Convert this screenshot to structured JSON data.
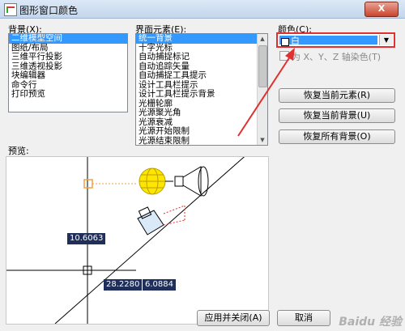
{
  "window": {
    "title": "图形窗口颜色",
    "close_label": "X"
  },
  "context": {
    "label": "背景(X):",
    "items": [
      "二维模型空间",
      "图纸/布局",
      "三维平行投影",
      "三维透视投影",
      "块编辑器",
      "命令行",
      "打印预览"
    ],
    "selected_index": 0
  },
  "interface_element": {
    "label": "界面元素(E):",
    "items": [
      "统一背景",
      "十字光标",
      "自动捕捉标记",
      "自动追踪矢量",
      "自动捕捉工具提示",
      "设计工具栏提示",
      "设计工具栏提示背景",
      "光栅轮廓",
      "光源聚光角",
      "光源衰减",
      "光源开始限制",
      "光源结束限制",
      "相机轮廓色",
      "相机视野/平截面"
    ],
    "selected_index": 0
  },
  "color": {
    "label": "颜色(C):",
    "value": "白",
    "swatch_color": "#ffffff",
    "tint_checkbox_label": "为 X、Y、Z 轴染色(T)",
    "tint_checked": false
  },
  "buttons": {
    "restore_element": "恢复当前元素(R)",
    "restore_context": "恢复当前背景(U)",
    "restore_all": "恢复所有背景(O)",
    "apply_close": "应用并关闭(A)",
    "cancel": "取消"
  },
  "preview": {
    "label": "预览:",
    "coord_1": "10.6063",
    "coord_2": "28.2280",
    "coord_3": "6.0884"
  },
  "annotation_color": "#e03030",
  "watermark": "Baidu 经验"
}
